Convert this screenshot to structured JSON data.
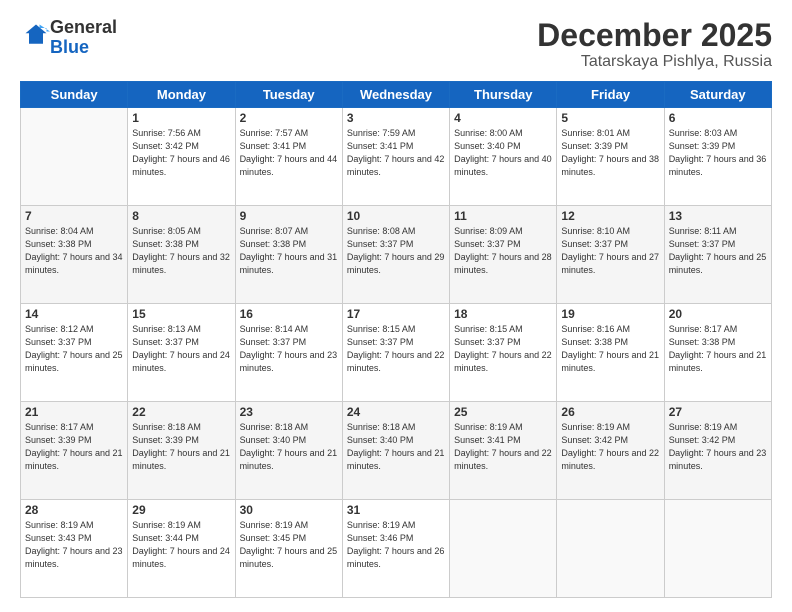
{
  "logo": {
    "general": "General",
    "blue": "Blue"
  },
  "title": "December 2025",
  "subtitle": "Tatarskaya Pishlya, Russia",
  "days_of_week": [
    "Sunday",
    "Monday",
    "Tuesday",
    "Wednesday",
    "Thursday",
    "Friday",
    "Saturday"
  ],
  "weeks": [
    [
      {
        "day": "",
        "empty": true
      },
      {
        "day": "1",
        "sunrise": "Sunrise: 7:56 AM",
        "sunset": "Sunset: 3:42 PM",
        "daylight": "Daylight: 7 hours and 46 minutes."
      },
      {
        "day": "2",
        "sunrise": "Sunrise: 7:57 AM",
        "sunset": "Sunset: 3:41 PM",
        "daylight": "Daylight: 7 hours and 44 minutes."
      },
      {
        "day": "3",
        "sunrise": "Sunrise: 7:59 AM",
        "sunset": "Sunset: 3:41 PM",
        "daylight": "Daylight: 7 hours and 42 minutes."
      },
      {
        "day": "4",
        "sunrise": "Sunrise: 8:00 AM",
        "sunset": "Sunset: 3:40 PM",
        "daylight": "Daylight: 7 hours and 40 minutes."
      },
      {
        "day": "5",
        "sunrise": "Sunrise: 8:01 AM",
        "sunset": "Sunset: 3:39 PM",
        "daylight": "Daylight: 7 hours and 38 minutes."
      },
      {
        "day": "6",
        "sunrise": "Sunrise: 8:03 AM",
        "sunset": "Sunset: 3:39 PM",
        "daylight": "Daylight: 7 hours and 36 minutes."
      }
    ],
    [
      {
        "day": "7",
        "sunrise": "Sunrise: 8:04 AM",
        "sunset": "Sunset: 3:38 PM",
        "daylight": "Daylight: 7 hours and 34 minutes."
      },
      {
        "day": "8",
        "sunrise": "Sunrise: 8:05 AM",
        "sunset": "Sunset: 3:38 PM",
        "daylight": "Daylight: 7 hours and 32 minutes."
      },
      {
        "day": "9",
        "sunrise": "Sunrise: 8:07 AM",
        "sunset": "Sunset: 3:38 PM",
        "daylight": "Daylight: 7 hours and 31 minutes."
      },
      {
        "day": "10",
        "sunrise": "Sunrise: 8:08 AM",
        "sunset": "Sunset: 3:37 PM",
        "daylight": "Daylight: 7 hours and 29 minutes."
      },
      {
        "day": "11",
        "sunrise": "Sunrise: 8:09 AM",
        "sunset": "Sunset: 3:37 PM",
        "daylight": "Daylight: 7 hours and 28 minutes."
      },
      {
        "day": "12",
        "sunrise": "Sunrise: 8:10 AM",
        "sunset": "Sunset: 3:37 PM",
        "daylight": "Daylight: 7 hours and 27 minutes."
      },
      {
        "day": "13",
        "sunrise": "Sunrise: 8:11 AM",
        "sunset": "Sunset: 3:37 PM",
        "daylight": "Daylight: 7 hours and 25 minutes."
      }
    ],
    [
      {
        "day": "14",
        "sunrise": "Sunrise: 8:12 AM",
        "sunset": "Sunset: 3:37 PM",
        "daylight": "Daylight: 7 hours and 25 minutes."
      },
      {
        "day": "15",
        "sunrise": "Sunrise: 8:13 AM",
        "sunset": "Sunset: 3:37 PM",
        "daylight": "Daylight: 7 hours and 24 minutes."
      },
      {
        "day": "16",
        "sunrise": "Sunrise: 8:14 AM",
        "sunset": "Sunset: 3:37 PM",
        "daylight": "Daylight: 7 hours and 23 minutes."
      },
      {
        "day": "17",
        "sunrise": "Sunrise: 8:15 AM",
        "sunset": "Sunset: 3:37 PM",
        "daylight": "Daylight: 7 hours and 22 minutes."
      },
      {
        "day": "18",
        "sunrise": "Sunrise: 8:15 AM",
        "sunset": "Sunset: 3:37 PM",
        "daylight": "Daylight: 7 hours and 22 minutes."
      },
      {
        "day": "19",
        "sunrise": "Sunrise: 8:16 AM",
        "sunset": "Sunset: 3:38 PM",
        "daylight": "Daylight: 7 hours and 21 minutes."
      },
      {
        "day": "20",
        "sunrise": "Sunrise: 8:17 AM",
        "sunset": "Sunset: 3:38 PM",
        "daylight": "Daylight: 7 hours and 21 minutes."
      }
    ],
    [
      {
        "day": "21",
        "sunrise": "Sunrise: 8:17 AM",
        "sunset": "Sunset: 3:39 PM",
        "daylight": "Daylight: 7 hours and 21 minutes."
      },
      {
        "day": "22",
        "sunrise": "Sunrise: 8:18 AM",
        "sunset": "Sunset: 3:39 PM",
        "daylight": "Daylight: 7 hours and 21 minutes."
      },
      {
        "day": "23",
        "sunrise": "Sunrise: 8:18 AM",
        "sunset": "Sunset: 3:40 PM",
        "daylight": "Daylight: 7 hours and 21 minutes."
      },
      {
        "day": "24",
        "sunrise": "Sunrise: 8:18 AM",
        "sunset": "Sunset: 3:40 PM",
        "daylight": "Daylight: 7 hours and 21 minutes."
      },
      {
        "day": "25",
        "sunrise": "Sunrise: 8:19 AM",
        "sunset": "Sunset: 3:41 PM",
        "daylight": "Daylight: 7 hours and 22 minutes."
      },
      {
        "day": "26",
        "sunrise": "Sunrise: 8:19 AM",
        "sunset": "Sunset: 3:42 PM",
        "daylight": "Daylight: 7 hours and 22 minutes."
      },
      {
        "day": "27",
        "sunrise": "Sunrise: 8:19 AM",
        "sunset": "Sunset: 3:42 PM",
        "daylight": "Daylight: 7 hours and 23 minutes."
      }
    ],
    [
      {
        "day": "28",
        "sunrise": "Sunrise: 8:19 AM",
        "sunset": "Sunset: 3:43 PM",
        "daylight": "Daylight: 7 hours and 23 minutes."
      },
      {
        "day": "29",
        "sunrise": "Sunrise: 8:19 AM",
        "sunset": "Sunset: 3:44 PM",
        "daylight": "Daylight: 7 hours and 24 minutes."
      },
      {
        "day": "30",
        "sunrise": "Sunrise: 8:19 AM",
        "sunset": "Sunset: 3:45 PM",
        "daylight": "Daylight: 7 hours and 25 minutes."
      },
      {
        "day": "31",
        "sunrise": "Sunrise: 8:19 AM",
        "sunset": "Sunset: 3:46 PM",
        "daylight": "Daylight: 7 hours and 26 minutes."
      },
      {
        "day": "",
        "empty": true
      },
      {
        "day": "",
        "empty": true
      },
      {
        "day": "",
        "empty": true
      }
    ]
  ]
}
